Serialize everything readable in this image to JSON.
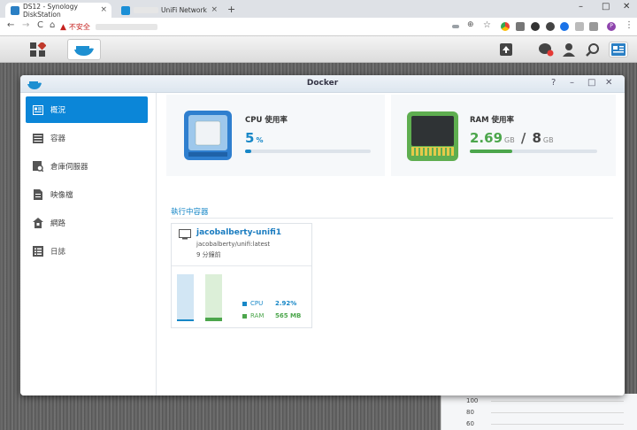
{
  "browser": {
    "tabs": [
      {
        "label": "DS12 - Synology DiskStation",
        "close": "×"
      },
      {
        "label": "UniFi Network",
        "close": "×"
      }
    ],
    "new_tab": "+",
    "window_controls": {
      "minimize": "–",
      "maximize": "□",
      "close": "✕"
    },
    "nav": {
      "back": "←",
      "forward": "→",
      "reload": "C",
      "home": "⌂"
    },
    "security_text": "不安全",
    "profile_initial": "P"
  },
  "docker": {
    "window_title": "Docker",
    "controls": {
      "help": "?",
      "minimize": "–",
      "maximize": "□",
      "close": "✕"
    },
    "sidebar": [
      {
        "label": "概況",
        "icon": "overview-icon"
      },
      {
        "label": "容器",
        "icon": "container-icon"
      },
      {
        "label": "倉庫伺服器",
        "icon": "registry-icon"
      },
      {
        "label": "映像檔",
        "icon": "image-icon"
      },
      {
        "label": "網路",
        "icon": "network-icon"
      },
      {
        "label": "日誌",
        "icon": "log-icon"
      }
    ],
    "cpu": {
      "label": "CPU 使用率",
      "value": "5",
      "unit": "%",
      "percent": 5
    },
    "ram": {
      "label": "RAM 使用率",
      "used": "2.69",
      "used_unit": "GB",
      "sep": "/",
      "total": "8",
      "total_unit": "GB",
      "percent": 33.6
    },
    "running_section": "執行中容器",
    "container": {
      "name": "jacobalberty-unifi1",
      "image": "jacobalberty/unifi:latest",
      "uptime": "9 分鐘前",
      "cpu_label": "CPU",
      "cpu_value": "2.92%",
      "cpu_percent": 2.92,
      "ram_label": "RAM",
      "ram_value": "565 MB",
      "ram_percent": 7
    }
  },
  "background_window": {
    "axis_labels": [
      "100",
      "80",
      "60"
    ]
  },
  "colors": {
    "accent": "#0b86d8",
    "cpu": "#1787c7",
    "ram": "#4ca64c",
    "cpu_bar_bg": "#d2e6f4",
    "ram_bar_bg": "#dcefd8"
  }
}
